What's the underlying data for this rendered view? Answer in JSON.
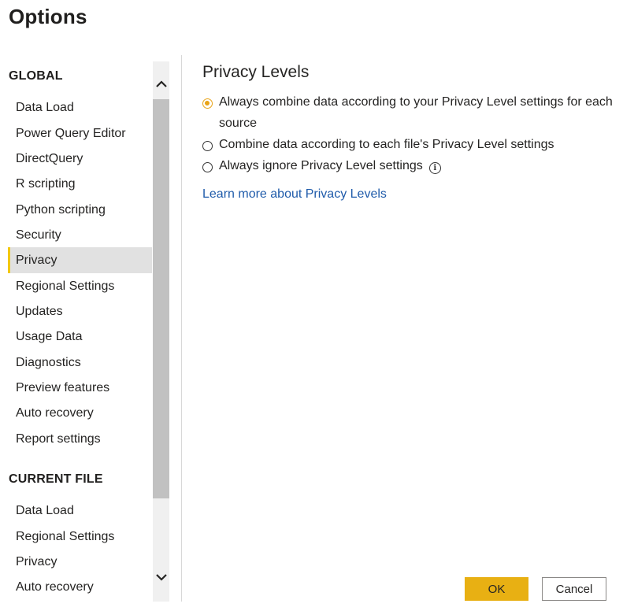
{
  "window": {
    "title": "Options"
  },
  "nav": {
    "global_heading": "GLOBAL",
    "global_items": [
      {
        "label": "Data Load"
      },
      {
        "label": "Power Query Editor"
      },
      {
        "label": "DirectQuery"
      },
      {
        "label": "R scripting"
      },
      {
        "label": "Python scripting"
      },
      {
        "label": "Security"
      },
      {
        "label": "Privacy",
        "selected": true
      },
      {
        "label": "Regional Settings"
      },
      {
        "label": "Updates"
      },
      {
        "label": "Usage Data"
      },
      {
        "label": "Diagnostics"
      },
      {
        "label": "Preview features"
      },
      {
        "label": "Auto recovery"
      },
      {
        "label": "Report settings"
      }
    ],
    "current_file_heading": "CURRENT FILE",
    "current_file_items": [
      {
        "label": "Data Load"
      },
      {
        "label": "Regional Settings"
      },
      {
        "label": "Privacy"
      },
      {
        "label": "Auto recovery"
      }
    ]
  },
  "content": {
    "title": "Privacy Levels",
    "options": [
      {
        "label": "Always combine data according to your Privacy Level settings for each source",
        "checked": true
      },
      {
        "label": "Combine data according to each file's Privacy Level settings",
        "checked": false
      },
      {
        "label": "Always ignore Privacy Level settings",
        "checked": false,
        "info_icon": "info-icon"
      }
    ],
    "learn_more_link": "Learn more about Privacy Levels"
  },
  "footer": {
    "ok_label": "OK",
    "cancel_label": "Cancel"
  },
  "colors": {
    "accent": "#f2c811",
    "ok_button": "#e8b013",
    "link": "#1f5baa",
    "radio_checked": "#e8a317"
  }
}
